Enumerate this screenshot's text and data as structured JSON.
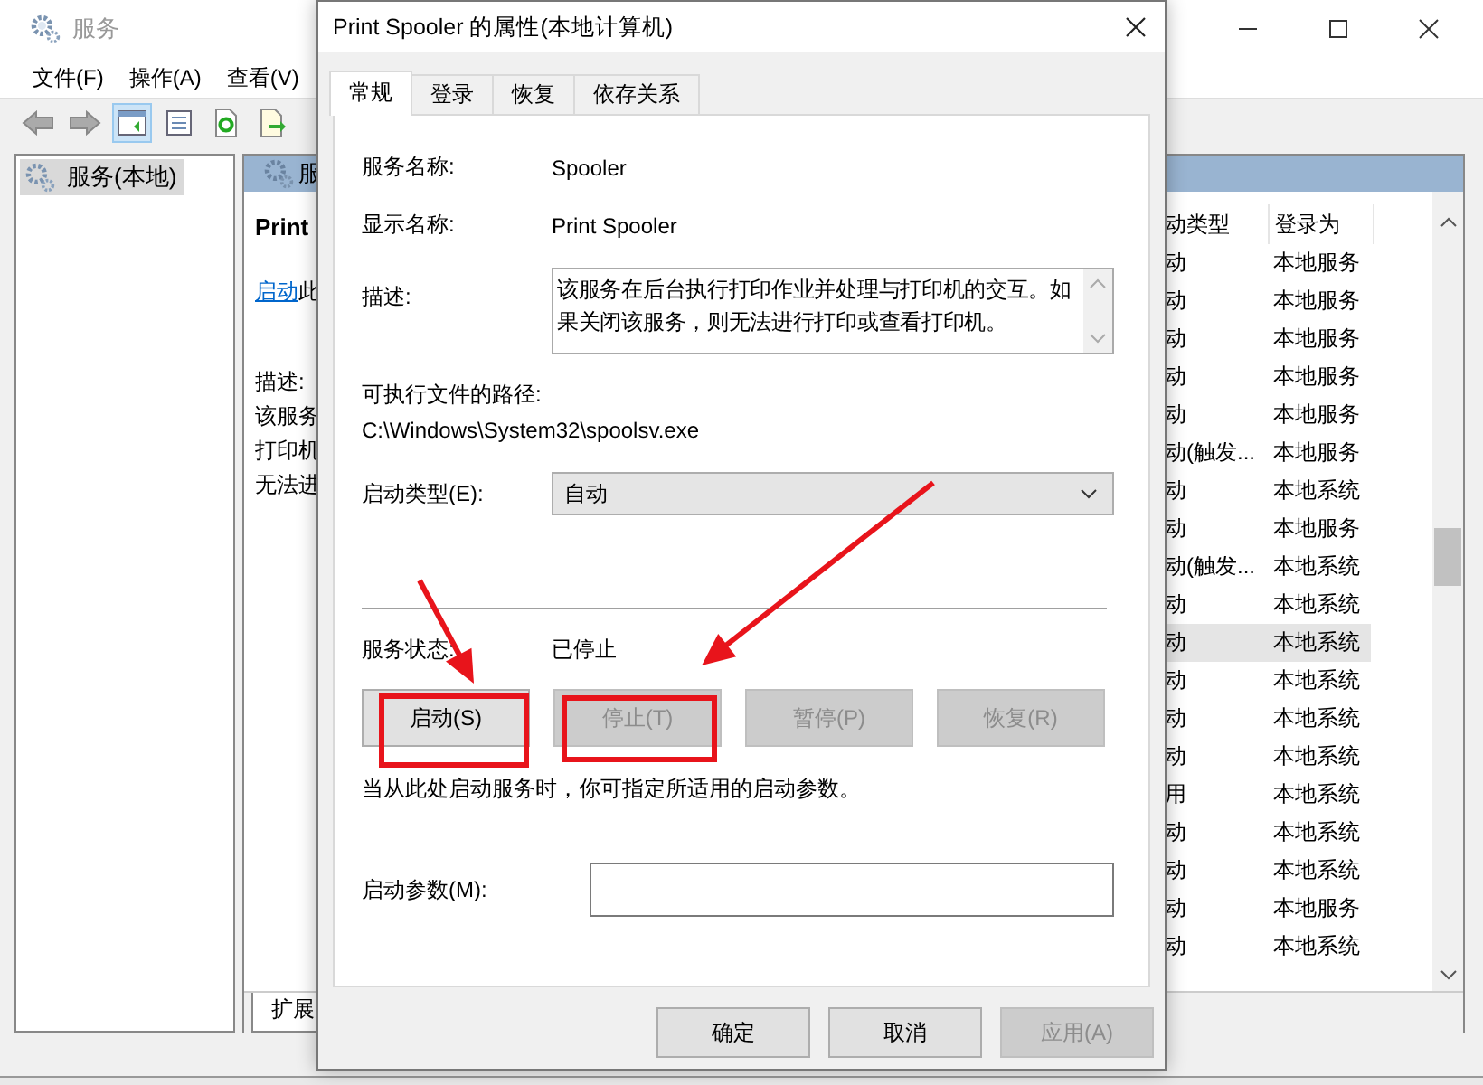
{
  "services_window": {
    "title": "服务",
    "menu": [
      "文件(F)",
      "操作(A)",
      "查看(V)"
    ],
    "toolbar": [
      {
        "kind": "back",
        "on": false
      },
      {
        "kind": "forward",
        "on": false
      },
      {
        "kind": "pane",
        "on": true
      },
      {
        "kind": "properties",
        "on": false
      },
      {
        "kind": "refresh",
        "on": false
      },
      {
        "kind": "export",
        "on": false
      }
    ],
    "tree": [
      {
        "label": "服务(本地)",
        "selected": true
      }
    ],
    "header": "服",
    "detail": {
      "title": "Print",
      "link": "启动",
      "link_rest": "此",
      "description_label": "描述:",
      "description_lines": [
        "该服务",
        "打印机",
        "无法进"
      ]
    },
    "columns": [
      "动类型",
      "登录为"
    ],
    "rows": [
      {
        "startup": "动",
        "logon": "本地服务",
        "selected": false
      },
      {
        "startup": "动",
        "logon": "本地服务",
        "selected": false
      },
      {
        "startup": "动",
        "logon": "本地服务",
        "selected": false
      },
      {
        "startup": "动",
        "logon": "本地服务",
        "selected": false
      },
      {
        "startup": "动",
        "logon": "本地服务",
        "selected": false
      },
      {
        "startup": "动(触发...",
        "logon": "本地服务",
        "selected": false
      },
      {
        "startup": "动",
        "logon": "本地系统",
        "selected": false
      },
      {
        "startup": "动",
        "logon": "本地服务",
        "selected": false
      },
      {
        "startup": "动(触发...",
        "logon": "本地系统",
        "selected": false
      },
      {
        "startup": "动",
        "logon": "本地系统",
        "selected": false
      },
      {
        "startup": "动",
        "logon": "本地系统",
        "selected": true
      },
      {
        "startup": "动",
        "logon": "本地系统",
        "selected": false
      },
      {
        "startup": "动",
        "logon": "本地系统",
        "selected": false
      },
      {
        "startup": "动",
        "logon": "本地系统",
        "selected": false
      },
      {
        "startup": "用",
        "logon": "本地系统",
        "selected": false
      },
      {
        "startup": "动",
        "logon": "本地系统",
        "selected": false
      },
      {
        "startup": "动",
        "logon": "本地系统",
        "selected": false
      },
      {
        "startup": "动",
        "logon": "本地服务",
        "selected": false
      },
      {
        "startup": "动",
        "logon": "本地系统",
        "selected": false
      }
    ],
    "bottom_tabs": [
      {
        "label": "扩展",
        "selected": true
      }
    ]
  },
  "dialog": {
    "title": "Print Spooler 的属性(本地计算机)",
    "tabs": [
      {
        "label": "常规",
        "selected": true
      },
      {
        "label": "登录",
        "selected": false
      },
      {
        "label": "恢复",
        "selected": false
      },
      {
        "label": "依存关系",
        "selected": false
      }
    ],
    "service_name": {
      "label": "服务名称:",
      "value": "Spooler"
    },
    "display_name": {
      "label": "显示名称:",
      "value": "Print Spooler"
    },
    "description": {
      "label": "描述:",
      "value": "该服务在后台执行打印作业并处理与打印机的交互。如果关闭该服务，则无法进行打印或查看打印机。"
    },
    "path": {
      "label": "可执行文件的路径:",
      "value": "C:\\Windows\\System32\\spoolsv.exe"
    },
    "startup_type": {
      "label": "启动类型(E):",
      "value": "自动"
    },
    "status": {
      "label": "服务状态:",
      "value": "已停止"
    },
    "control_buttons": [
      {
        "label": "启动(S)",
        "disabled": false
      },
      {
        "label": "停止(T)",
        "disabled": true
      },
      {
        "label": "暂停(P)",
        "disabled": true
      },
      {
        "label": "恢复(R)",
        "disabled": true
      }
    ],
    "hint": "当从此处启动服务时，你可指定所适用的启动参数。",
    "start_params": {
      "label": "启动参数(M):"
    },
    "buttons": [
      {
        "label": "确定",
        "disabled": false
      },
      {
        "label": "取消",
        "disabled": false
      },
      {
        "label": "应用(A)",
        "disabled": true
      }
    ]
  }
}
